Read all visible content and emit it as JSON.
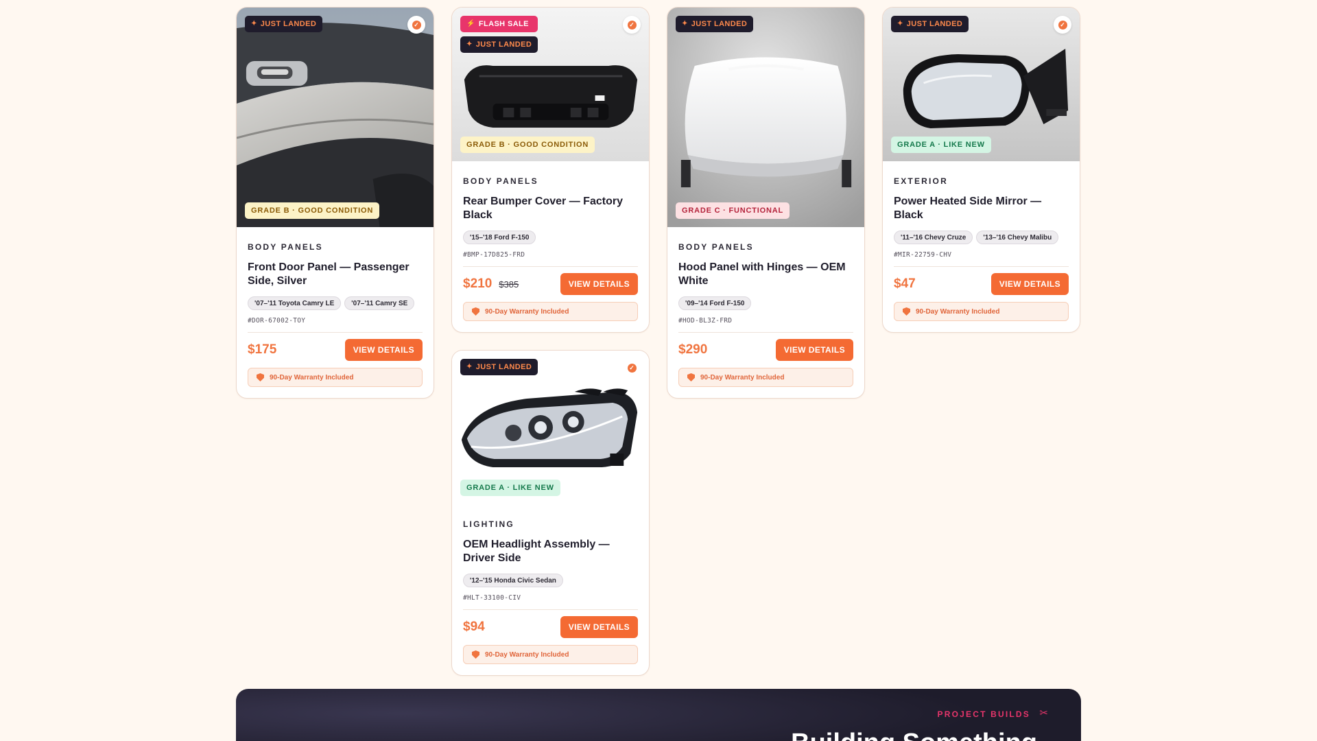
{
  "products": [
    {
      "badges": [
        "Just Landed"
      ],
      "grade": "Grade B · Good Condition",
      "category": "Body Panels",
      "title": "Front Door Panel — Passenger Side, Silver",
      "fits": [
        "'07–'11 Toyota Camry LE",
        "'07–'11 Camry SE"
      ],
      "sku": "#DOR-67002-TOY",
      "price": "$175",
      "was": "",
      "button": "View Details",
      "warranty": "90-Day Warranty Included"
    },
    {
      "badges": [
        "Flash Sale",
        "Just Landed"
      ],
      "grade": "Grade B · Good Condition",
      "category": "Body Panels",
      "title": "Rear Bumper Cover — Factory Black",
      "fits": [
        "'15–'18 Ford F-150"
      ],
      "sku": "#BMP-17D825-FRD",
      "price": "$210",
      "was": "$385",
      "button": "View Details",
      "warranty": "90-Day Warranty Included"
    },
    {
      "badges": [
        "Just Landed"
      ],
      "grade": "Grade A · Like New",
      "category": "Lighting",
      "title": "OEM Headlight Assembly — Driver Side",
      "fits": [
        "'12–'15 Honda Civic Sedan"
      ],
      "sku": "#HLT-33100-CIV",
      "price": "$94",
      "was": "",
      "button": "View Details",
      "warranty": "90-Day Warranty Included"
    },
    {
      "badges": [
        "Just Landed"
      ],
      "grade": "Grade C · Functional",
      "category": "Body Panels",
      "title": "Hood Panel with Hinges — OEM White",
      "fits": [
        "'09–'14 Ford F-150"
      ],
      "sku": "#HOD-BL3Z-FRD",
      "price": "$290",
      "was": "",
      "button": "View Details",
      "warranty": "90-Day Warranty Included"
    },
    {
      "badges": [
        "Just Landed"
      ],
      "grade": "Grade A · Like New",
      "category": "Exterior",
      "title": "Power Heated Side Mirror — Black",
      "fits": [
        "'11–'16 Chevy Cruze",
        "'13–'16 Chevy Malibu"
      ],
      "sku": "#MIR-22759-CHV",
      "price": "$47",
      "was": "",
      "button": "View Details",
      "warranty": "90-Day Warranty Included"
    }
  ],
  "icons": {
    "just_landed": "sparkle-icon",
    "flash_sale": "bolt-icon",
    "verified": "verified-check-icon",
    "warranty": "shield-icon",
    "builds": "wrench-screwdriver-icon"
  },
  "banner": {
    "eyebrow": "Project Builds",
    "headline": "Building Something"
  },
  "colors": {
    "accent": "#f46a33",
    "flash": "#e8356b",
    "dark": "#1f1c2c",
    "page_bg": "#fff8f1"
  }
}
